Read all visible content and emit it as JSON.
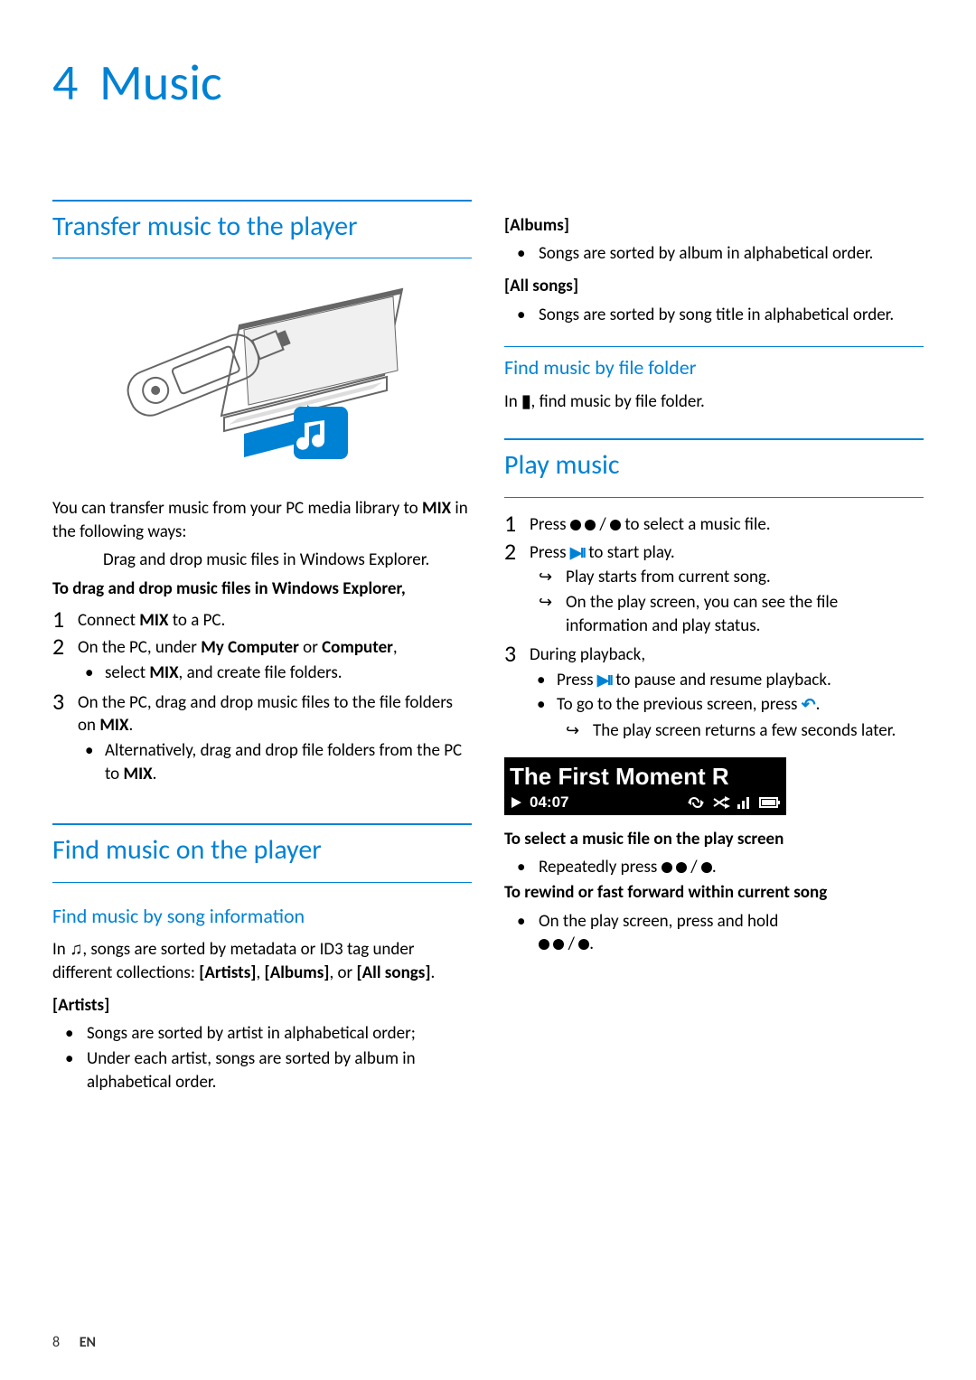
{
  "chapter": {
    "number": "4",
    "title": "Music"
  },
  "left": {
    "s1_title": "Transfer music to the player",
    "s1_intro_a": "You can transfer music from your PC media library to ",
    "s1_intro_mix": "MIX",
    "s1_intro_b": " in the following ways:",
    "s1_methods_1a": "Drag and drop music files in Windows Explorer.",
    "s1_dd_heading": "To drag and drop music files in Windows Explorer,",
    "steps": {
      "1_a": "Connect ",
      "1_mix": "MIX",
      "1_b": " to a PC.",
      "2_a": "On the PC, under ",
      "2_b": "My Computer",
      "2_c": " or ",
      "2_d": "Computer",
      "2_e": ",",
      "2_bullet_a": "select ",
      "2_bullet_mix": "MIX",
      "2_bullet_b": ", and create file folders.",
      "3_a": "On the PC, drag and drop music files to the file folders on ",
      "3_mix": "MIX",
      "3_b": ".",
      "3_alt_a": "Alternatively, drag and drop file folders from the PC to ",
      "3_alt_mix": "MIX",
      "3_alt_b": "."
    },
    "s2_title": "Find music on the player",
    "s2_sub1": "Find music by song information",
    "s2_p1_a": "In ",
    "s2_p1_b": ", songs are sorted by metadata or ID3 tag under different collections: ",
    "s2_p1_c": "[Artists]",
    "s2_p1_d": ", ",
    "s2_p1_e": "[Albums]",
    "s2_p1_f": ", or ",
    "s2_p1_g": "[All songs]",
    "s2_p1_h": ".",
    "artists_h": "[Artists]",
    "artists_b1": "Songs are sorted by artist in alphabetical order;",
    "artists_b2": "Under each artist, songs are sorted by album in alphabetical order."
  },
  "right": {
    "albums_h": "[Albums]",
    "albums_b1": "Songs are sorted by album in alphabetical order.",
    "allsongs_h": "[All songs]",
    "allsongs_b1": "Songs are sorted by song title in alphabetical order.",
    "sub_folder": "Find music by file folder",
    "folder_p_a": "In ",
    "folder_p_b": ", find music by file folder.",
    "s3_title": "Play music",
    "step1_a": "Press ",
    "step1_b": " / ",
    "step1_c": " to select a music file.",
    "step2_a": "Press ",
    "step2_b": " to start play.",
    "step2_r1": "Play starts from current song.",
    "step2_r2": "On the play screen, you can see the file information and play status.",
    "step3_a": "During playback,",
    "step3_b1_a": "Press ",
    "step3_b1_b": " to pause and resume playback.",
    "step3_b2_a": "To go to the previous screen, press ",
    "step3_b2_b": ".",
    "step3_b2_r": "The play screen returns a few seconds later.",
    "playscreen_title": "The First Moment R",
    "playscreen_time": "04:07",
    "post1_h": "To select a music file on the play screen",
    "post1_b_a": "Repeatedly press ",
    "post1_b_b": " / ",
    "post1_b_c": ".",
    "post2_h": "To rewind or fast forward within current song",
    "post2_b_a": "On the play screen, press and hold ",
    "post2_b_b": " / ",
    "post2_b_c": "."
  },
  "footer": {
    "page": "8",
    "lang": "EN"
  }
}
